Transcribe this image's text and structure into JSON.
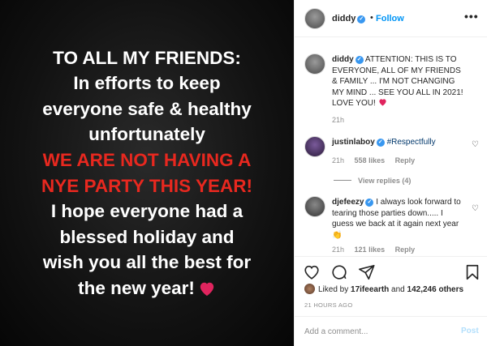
{
  "post_image": {
    "lines": [
      {
        "text": "TO ALL MY FRIENDS:",
        "color": "#ffffff"
      },
      {
        "text": "In efforts to keep",
        "color": "#ffffff"
      },
      {
        "text": "everyone safe & healthy",
        "color": "#ffffff"
      },
      {
        "text": "unfortunately",
        "color": "#ffffff"
      },
      {
        "text": "WE ARE  NOT HAVING A",
        "color": "#e8281f"
      },
      {
        "text": "NYE PARTY THIS YEAR!",
        "color": "#e8281f"
      },
      {
        "text": "I hope everyone had a",
        "color": "#ffffff"
      },
      {
        "text": "blessed holiday and",
        "color": "#ffffff"
      },
      {
        "text": "wish you all the best for",
        "color": "#ffffff"
      },
      {
        "text": "the new year!",
        "color": "#ffffff"
      }
    ],
    "end_icon": "red-heart-icon"
  },
  "header": {
    "username": "diddy",
    "separator": "•",
    "follow_label": "Follow",
    "more_label": "•••"
  },
  "caption": {
    "username": "diddy",
    "text": "ATTENTION: THIS IS TO EVERYONE, ALL OF MY FRIENDS & FAMILY ... I'M NOT CHANGING MY MIND ... SEE YOU ALL IN 2021! LOVE YOU!",
    "emoji_icon": "red-heart-icon",
    "time": "21h"
  },
  "comments": [
    {
      "username": "justinlaboy",
      "text": "#Respectfully",
      "time": "21h",
      "likes": "558 likes",
      "reply_label": "Reply",
      "view_replies": "View replies (4)"
    },
    {
      "username": "djefeezy",
      "text": "I always look forward to tearing those parties down..... I guess we back at it again next year",
      "emoji_icon": "clapping-hands-icon",
      "time": "21h",
      "likes": "121 likes",
      "reply_label": "Reply"
    }
  ],
  "actions": {
    "icons": [
      "heart-icon",
      "comment-icon",
      "share-icon",
      "bookmark-icon"
    ]
  },
  "likes_summary": {
    "prefix": "Liked by ",
    "user": "17ifeearth",
    "and": " and ",
    "count": "142,246 others"
  },
  "timestamp": "21 HOURS AGO",
  "add_comment": {
    "placeholder": "Add a comment...",
    "post_label": "Post"
  },
  "colors": {
    "accent_blue": "#0095f6",
    "link_blue": "#00376b",
    "post_disabled": "#b2dffc",
    "red_text": "#e8281f",
    "muted": "#8e8e8e"
  }
}
